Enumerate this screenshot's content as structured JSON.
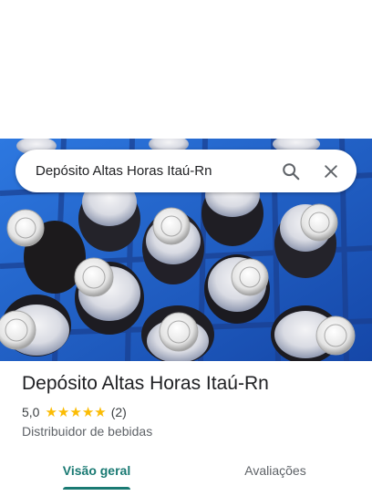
{
  "search": {
    "query": "Depósito Altas Horas Itaú-Rn"
  },
  "icons": {
    "search": "search-icon",
    "close": "close-icon"
  },
  "place": {
    "name": "Depósito Altas Horas Itaú-Rn",
    "rating": "5,0",
    "stars": 5,
    "review_count": "(2)",
    "category": "Distribuidor de bebidas"
  },
  "tabs": [
    {
      "label": "Visão geral",
      "active": true
    },
    {
      "label": "Avaliações",
      "active": false
    }
  ],
  "colors": {
    "accent": "#1a7a73",
    "star": "#fbbc04",
    "crate_blue": "#1e64c8"
  }
}
